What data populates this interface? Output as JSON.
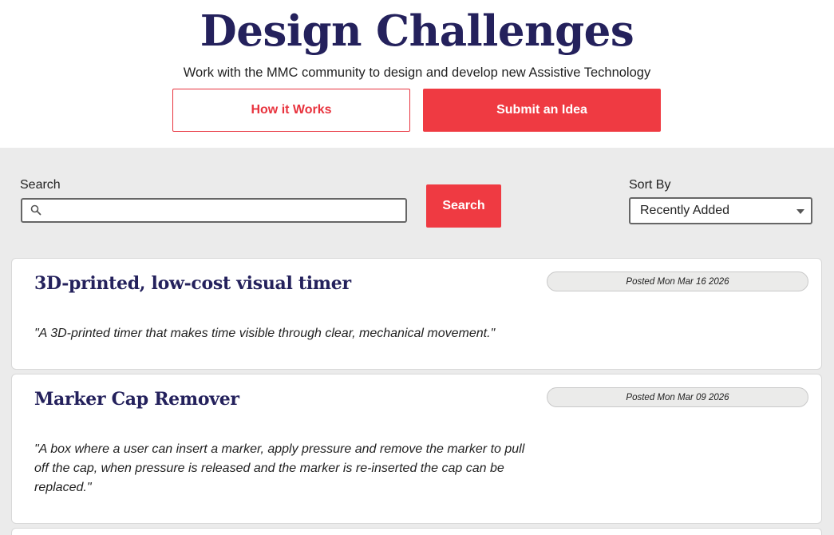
{
  "header": {
    "title": "Design Challenges",
    "subtitle": "Work with the MMC community to design and develop new Assistive Technology",
    "how_it_works_label": "How it Works",
    "submit_idea_label": "Submit an Idea"
  },
  "filters": {
    "search_label": "Search",
    "search_value": "",
    "search_button_label": "Search",
    "sort_label": "Sort By",
    "sort_value": "Recently Added"
  },
  "cards": [
    {
      "title": "3D-printed, low-cost visual timer",
      "date": "Posted Mon Mar 16 2026",
      "description": "\"A 3D-printed timer that makes time visible through clear, mechanical movement.\""
    },
    {
      "title": "Marker Cap Remover",
      "date": "Posted Mon Mar 09 2026",
      "description": "\"A box where a user can insert a marker, apply pressure and remove the marker to pull off the cap, when pressure is released and the marker is re-inserted the cap can be replaced.\""
    }
  ],
  "colors": {
    "brand_navy": "#24215c",
    "accent_red": "#ef3a42",
    "background_gray": "#ebebeb"
  },
  "icons": {
    "search": "search-icon",
    "sort_dropdown": "chevron-down-icon"
  }
}
